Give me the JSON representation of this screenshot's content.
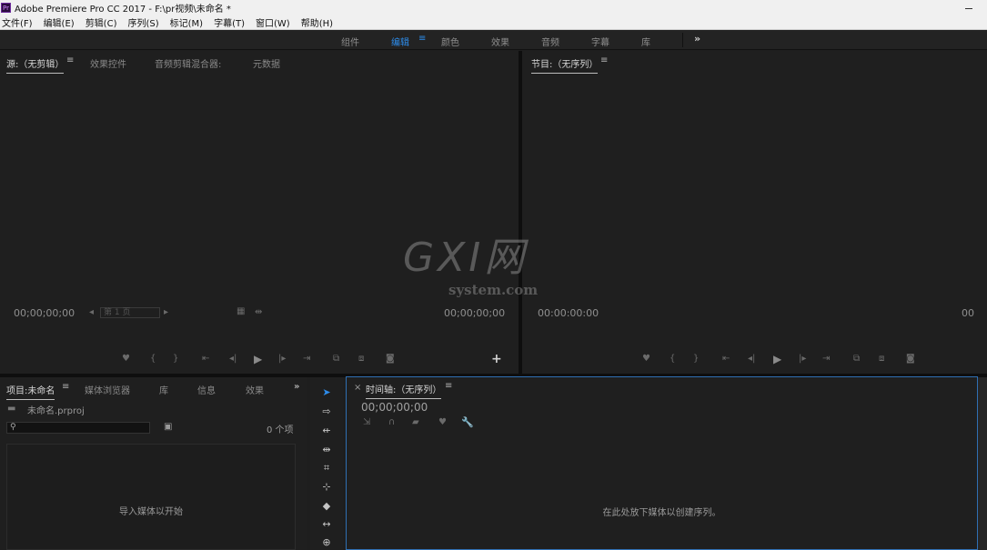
{
  "window": {
    "logo": "Pr",
    "title": "Adobe Premiere Pro CC 2017 - F:\\pr视频\\未命名 *"
  },
  "menu": [
    "文件(F)",
    "编辑(E)",
    "剪辑(C)",
    "序列(S)",
    "标记(M)",
    "字幕(T)",
    "窗口(W)",
    "帮助(H)"
  ],
  "workspaces": {
    "tabs": [
      "组件",
      "编辑",
      "颜色",
      "效果",
      "音频",
      "字幕",
      "库"
    ],
    "active": "编辑",
    "menu_glyph": "≡",
    "more_glyph": "»"
  },
  "source": {
    "tabs": [
      "源:（无剪辑）",
      "效果控件",
      "音频剪辑混合器:",
      "元数据"
    ],
    "menu_glyph": "≡",
    "timecode_left": "00;00;00;00",
    "timecode_right": "00;00;00;00",
    "page_select": "第 1 页",
    "add_glyph": "+"
  },
  "program": {
    "tab": "节目:（无序列）",
    "menu_glyph": "≡",
    "timecode_left": "00:00:00:00",
    "timecode_right": "00"
  },
  "project": {
    "tabs": [
      "项目:未命名",
      "媒体浏览器",
      "库",
      "信息",
      "效果"
    ],
    "menu_glyph": "≡",
    "more_glyph": "»",
    "file_name": "未命名.prproj",
    "search_placeholder": "",
    "item_count": "0 个项",
    "empty_message": "导入媒体以开始"
  },
  "timeline": {
    "close_glyph": "×",
    "tab": "时间轴:（无序列）",
    "menu_glyph": "≡",
    "timecode": "00;00;00;00",
    "empty_message": "在此处放下媒体以创建序列。"
  },
  "watermark": {
    "main": "GXI网",
    "sub": "system.com"
  },
  "colors": {
    "accent": "#2d8ceb",
    "panel_bg": "#1f1f1f",
    "timeline_border": "#2f6fb3"
  }
}
